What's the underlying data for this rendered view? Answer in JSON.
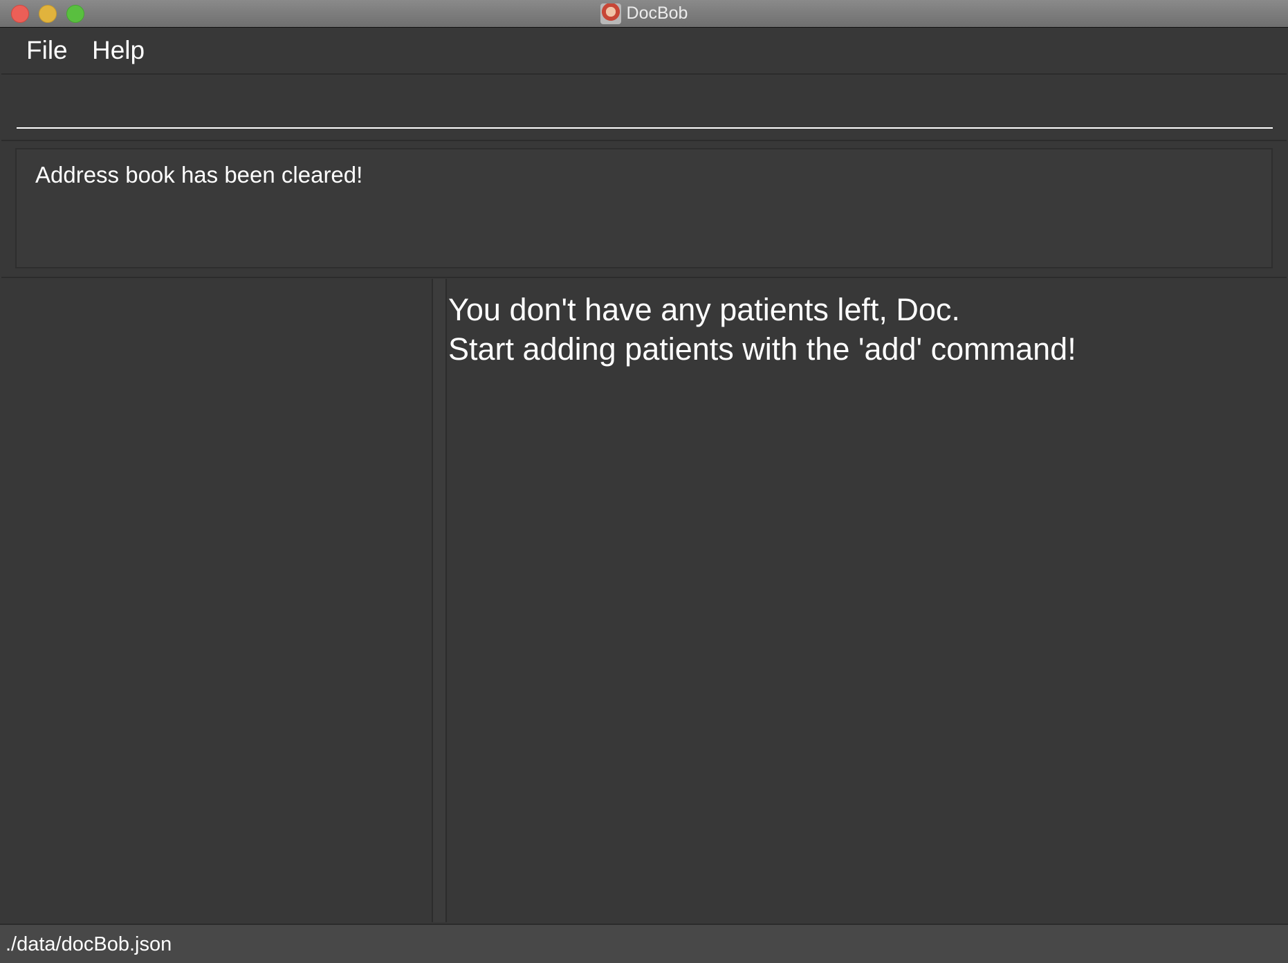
{
  "window": {
    "title": "DocBob"
  },
  "menu": {
    "items": [
      "File",
      "Help"
    ]
  },
  "command": {
    "value": "",
    "placeholder": ""
  },
  "result": {
    "message": "Address book has been cleared!"
  },
  "patients": {
    "empty_line1": "You don't have any patients left, Doc.",
    "empty_line2": "Start adding patients with the 'add' command!"
  },
  "status": {
    "file_path": "./data/docBob.json"
  },
  "colors": {
    "background": "#383838",
    "close_button": "#ec5f57",
    "minimize_button": "#e1b33d",
    "maximize_button": "#59bf3f"
  }
}
